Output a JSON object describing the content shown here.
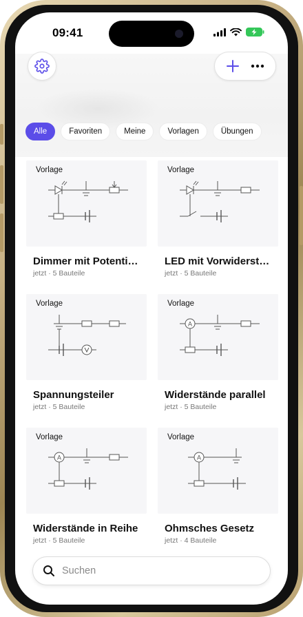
{
  "status": {
    "time": "09:41"
  },
  "filters": [
    {
      "label": "Alle",
      "active": true
    },
    {
      "label": "Favoriten",
      "active": false
    },
    {
      "label": "Meine",
      "active": false
    },
    {
      "label": "Vorlagen",
      "active": false
    },
    {
      "label": "Übungen",
      "active": false
    }
  ],
  "cards": [
    {
      "tag": "Vorlage",
      "title": "Dimmer mit Potentiometer",
      "time": "jetzt",
      "parts": "5 Bauteile"
    },
    {
      "tag": "Vorlage",
      "title": "LED mit Vorwiderstand",
      "time": "jetzt",
      "parts": "5 Bauteile"
    },
    {
      "tag": "Vorlage",
      "title": "Spannungsteiler",
      "time": "jetzt",
      "parts": "5 Bauteile"
    },
    {
      "tag": "Vorlage",
      "title": "Widerstände parallel",
      "time": "jetzt",
      "parts": "5 Bauteile"
    },
    {
      "tag": "Vorlage",
      "title": "Widerstände in Reihe",
      "time": "jetzt",
      "parts": "5 Bauteile"
    },
    {
      "tag": "Vorlage",
      "title": "Ohmsches Gesetz",
      "time": "jetzt",
      "parts": "4 Bauteile"
    }
  ],
  "meta_separator": "·",
  "search": {
    "placeholder": "Suchen"
  },
  "colors": {
    "accent": "#5b4de8",
    "battery": "#34c759"
  },
  "icons": {
    "settings": "gear-icon",
    "add": "plus-icon",
    "more": "ellipsis-icon",
    "search": "magnifier-icon"
  }
}
